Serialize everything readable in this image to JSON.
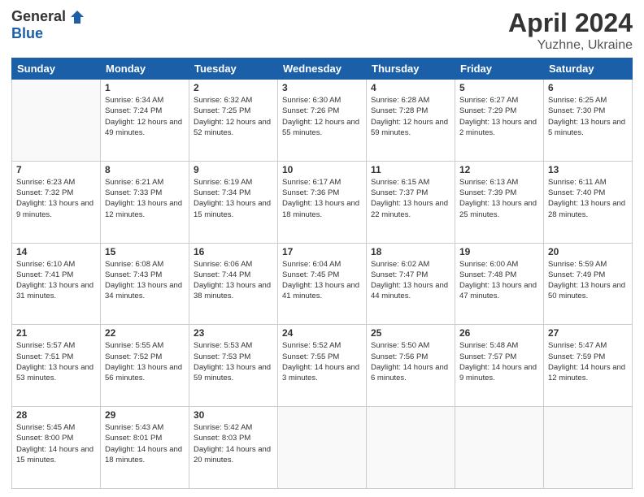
{
  "header": {
    "logo_general": "General",
    "logo_blue": "Blue",
    "title": "April 2024",
    "location": "Yuzhne, Ukraine"
  },
  "days_of_week": [
    "Sunday",
    "Monday",
    "Tuesday",
    "Wednesday",
    "Thursday",
    "Friday",
    "Saturday"
  ],
  "weeks": [
    [
      null,
      {
        "num": "1",
        "sunrise": "6:34 AM",
        "sunset": "7:24 PM",
        "daylight": "12 hours and 49 minutes."
      },
      {
        "num": "2",
        "sunrise": "6:32 AM",
        "sunset": "7:25 PM",
        "daylight": "12 hours and 52 minutes."
      },
      {
        "num": "3",
        "sunrise": "6:30 AM",
        "sunset": "7:26 PM",
        "daylight": "12 hours and 55 minutes."
      },
      {
        "num": "4",
        "sunrise": "6:28 AM",
        "sunset": "7:28 PM",
        "daylight": "12 hours and 59 minutes."
      },
      {
        "num": "5",
        "sunrise": "6:27 AM",
        "sunset": "7:29 PM",
        "daylight": "13 hours and 2 minutes."
      },
      {
        "num": "6",
        "sunrise": "6:25 AM",
        "sunset": "7:30 PM",
        "daylight": "13 hours and 5 minutes."
      }
    ],
    [
      {
        "num": "7",
        "sunrise": "6:23 AM",
        "sunset": "7:32 PM",
        "daylight": "13 hours and 9 minutes."
      },
      {
        "num": "8",
        "sunrise": "6:21 AM",
        "sunset": "7:33 PM",
        "daylight": "13 hours and 12 minutes."
      },
      {
        "num": "9",
        "sunrise": "6:19 AM",
        "sunset": "7:34 PM",
        "daylight": "13 hours and 15 minutes."
      },
      {
        "num": "10",
        "sunrise": "6:17 AM",
        "sunset": "7:36 PM",
        "daylight": "13 hours and 18 minutes."
      },
      {
        "num": "11",
        "sunrise": "6:15 AM",
        "sunset": "7:37 PM",
        "daylight": "13 hours and 22 minutes."
      },
      {
        "num": "12",
        "sunrise": "6:13 AM",
        "sunset": "7:39 PM",
        "daylight": "13 hours and 25 minutes."
      },
      {
        "num": "13",
        "sunrise": "6:11 AM",
        "sunset": "7:40 PM",
        "daylight": "13 hours and 28 minutes."
      }
    ],
    [
      {
        "num": "14",
        "sunrise": "6:10 AM",
        "sunset": "7:41 PM",
        "daylight": "13 hours and 31 minutes."
      },
      {
        "num": "15",
        "sunrise": "6:08 AM",
        "sunset": "7:43 PM",
        "daylight": "13 hours and 34 minutes."
      },
      {
        "num": "16",
        "sunrise": "6:06 AM",
        "sunset": "7:44 PM",
        "daylight": "13 hours and 38 minutes."
      },
      {
        "num": "17",
        "sunrise": "6:04 AM",
        "sunset": "7:45 PM",
        "daylight": "13 hours and 41 minutes."
      },
      {
        "num": "18",
        "sunrise": "6:02 AM",
        "sunset": "7:47 PM",
        "daylight": "13 hours and 44 minutes."
      },
      {
        "num": "19",
        "sunrise": "6:00 AM",
        "sunset": "7:48 PM",
        "daylight": "13 hours and 47 minutes."
      },
      {
        "num": "20",
        "sunrise": "5:59 AM",
        "sunset": "7:49 PM",
        "daylight": "13 hours and 50 minutes."
      }
    ],
    [
      {
        "num": "21",
        "sunrise": "5:57 AM",
        "sunset": "7:51 PM",
        "daylight": "13 hours and 53 minutes."
      },
      {
        "num": "22",
        "sunrise": "5:55 AM",
        "sunset": "7:52 PM",
        "daylight": "13 hours and 56 minutes."
      },
      {
        "num": "23",
        "sunrise": "5:53 AM",
        "sunset": "7:53 PM",
        "daylight": "13 hours and 59 minutes."
      },
      {
        "num": "24",
        "sunrise": "5:52 AM",
        "sunset": "7:55 PM",
        "daylight": "14 hours and 3 minutes."
      },
      {
        "num": "25",
        "sunrise": "5:50 AM",
        "sunset": "7:56 PM",
        "daylight": "14 hours and 6 minutes."
      },
      {
        "num": "26",
        "sunrise": "5:48 AM",
        "sunset": "7:57 PM",
        "daylight": "14 hours and 9 minutes."
      },
      {
        "num": "27",
        "sunrise": "5:47 AM",
        "sunset": "7:59 PM",
        "daylight": "14 hours and 12 minutes."
      }
    ],
    [
      {
        "num": "28",
        "sunrise": "5:45 AM",
        "sunset": "8:00 PM",
        "daylight": "14 hours and 15 minutes."
      },
      {
        "num": "29",
        "sunrise": "5:43 AM",
        "sunset": "8:01 PM",
        "daylight": "14 hours and 18 minutes."
      },
      {
        "num": "30",
        "sunrise": "5:42 AM",
        "sunset": "8:03 PM",
        "daylight": "14 hours and 20 minutes."
      },
      null,
      null,
      null,
      null
    ]
  ]
}
